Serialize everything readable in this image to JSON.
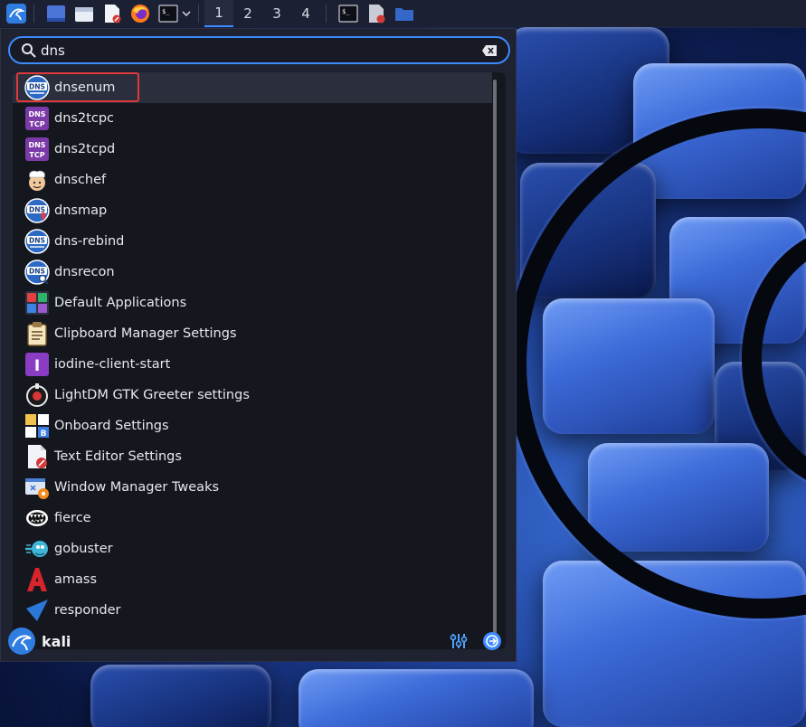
{
  "panel": {
    "workspaces": [
      "1",
      "2",
      "3",
      "4"
    ],
    "active_workspace": "1",
    "launchers": [
      "kali-menu-icon",
      "show-desktop-icon",
      "file-manager-icon",
      "text-editor-icon",
      "firefox-icon",
      "terminal-icon"
    ]
  },
  "search": {
    "value": "dns",
    "clear_icon": "backspace-clear-icon"
  },
  "results": [
    {
      "label": "dnsenum",
      "icon": "dns-icon"
    },
    {
      "label": "dns2tcpc",
      "icon": "dns-tcp-icon"
    },
    {
      "label": "dns2tcpd",
      "icon": "dns-tcp-icon"
    },
    {
      "label": "dnschef",
      "icon": "chef-icon"
    },
    {
      "label": "dnsmap",
      "icon": "dns-map-icon"
    },
    {
      "label": "dns-rebind",
      "icon": "dns-icon"
    },
    {
      "label": "dnsrecon",
      "icon": "dns-search-icon"
    },
    {
      "label": "Default Applications",
      "icon": "default-apps-icon"
    },
    {
      "label": "Clipboard Manager Settings",
      "icon": "clipboard-icon"
    },
    {
      "label": "iodine-client-start",
      "icon": "iodine-icon"
    },
    {
      "label": "LightDM GTK Greeter settings",
      "icon": "lightdm-icon"
    },
    {
      "label": "Onboard Settings",
      "icon": "keyboard-icon"
    },
    {
      "label": "Text Editor Settings",
      "icon": "text-editor-icon"
    },
    {
      "label": "Window Manager Tweaks",
      "icon": "window-tweaks-icon"
    },
    {
      "label": "fierce",
      "icon": "fierce-icon"
    },
    {
      "label": "gobuster",
      "icon": "gobuster-icon"
    },
    {
      "label": "amass",
      "icon": "amass-icon"
    },
    {
      "label": "responder",
      "icon": "responder-icon"
    }
  ],
  "selected_index": 0,
  "footer": {
    "user": "kali"
  },
  "colors": {
    "accent": "#3d8bff",
    "highlight_border": "#e0393a"
  }
}
